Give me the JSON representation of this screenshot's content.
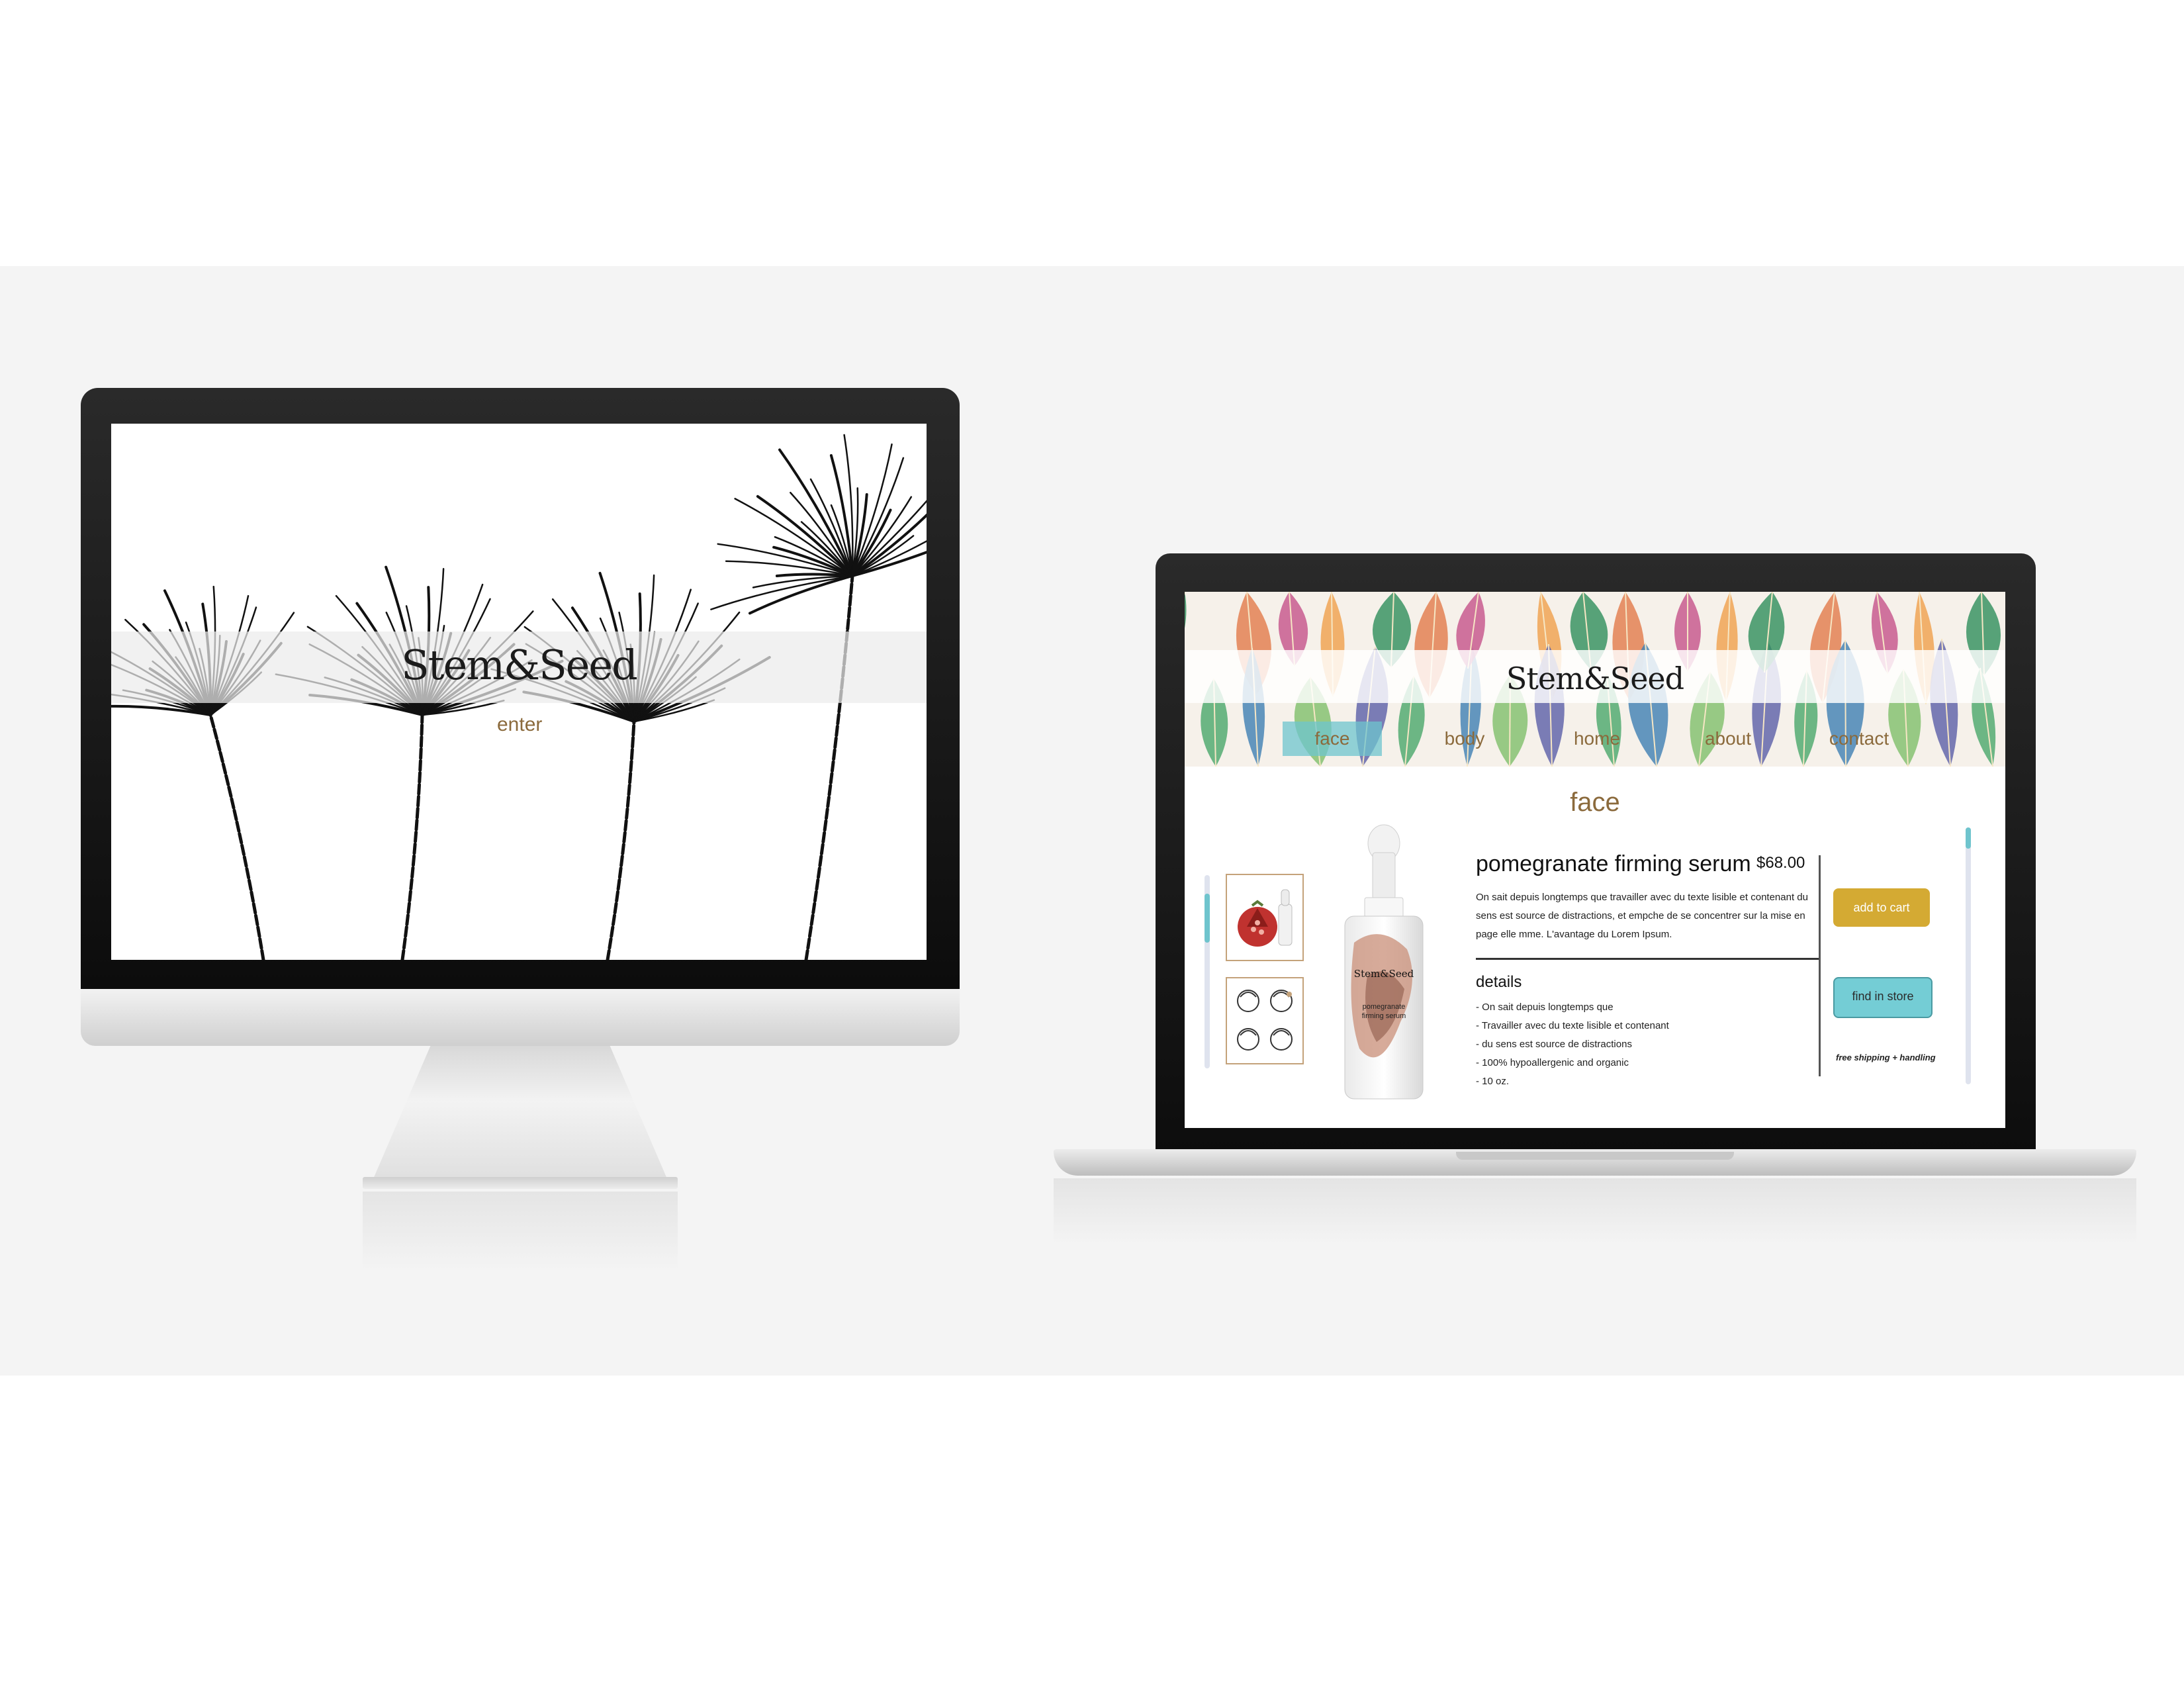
{
  "desktop": {
    "logo": "Stem&Seed",
    "enter_link": "enter"
  },
  "laptop": {
    "logo": "Stem&Seed",
    "nav": [
      {
        "label": "face",
        "active": true
      },
      {
        "label": "body",
        "active": false
      },
      {
        "label": "home",
        "active": false
      },
      {
        "label": "about",
        "active": false
      },
      {
        "label": "contact",
        "active": false
      }
    ],
    "heading": "face",
    "product": {
      "name": "pomegranate firming serum",
      "price": "$68.00",
      "description": "On sait depuis longtemps que travailler avec du texte lisible et contenant du sens est source de distractions, et empche de se concentrer sur la mise en page elle mme. L'avantage du Lorem Ipsum.",
      "bottle_brand": "Stem&Seed",
      "bottle_label_line1": "pomegranate",
      "bottle_label_line2": "firming serum"
    },
    "details": {
      "title": "details",
      "items": [
        "- On sait depuis longtemps que",
        "- Travailler avec du texte lisible et contenant",
        "- du sens est source de distractions",
        "- 100% hypoallergenic and organic",
        "- 10 oz."
      ]
    },
    "buttons": {
      "add_to_cart": "add to cart",
      "find_in_store": "find in store"
    },
    "shipping_note": "free shipping + handling"
  },
  "colors": {
    "accent_brown": "#8b6a3c",
    "button_gold": "#d4aa33",
    "button_teal": "#74cdd5",
    "nav_active": "#6ec4cd"
  }
}
